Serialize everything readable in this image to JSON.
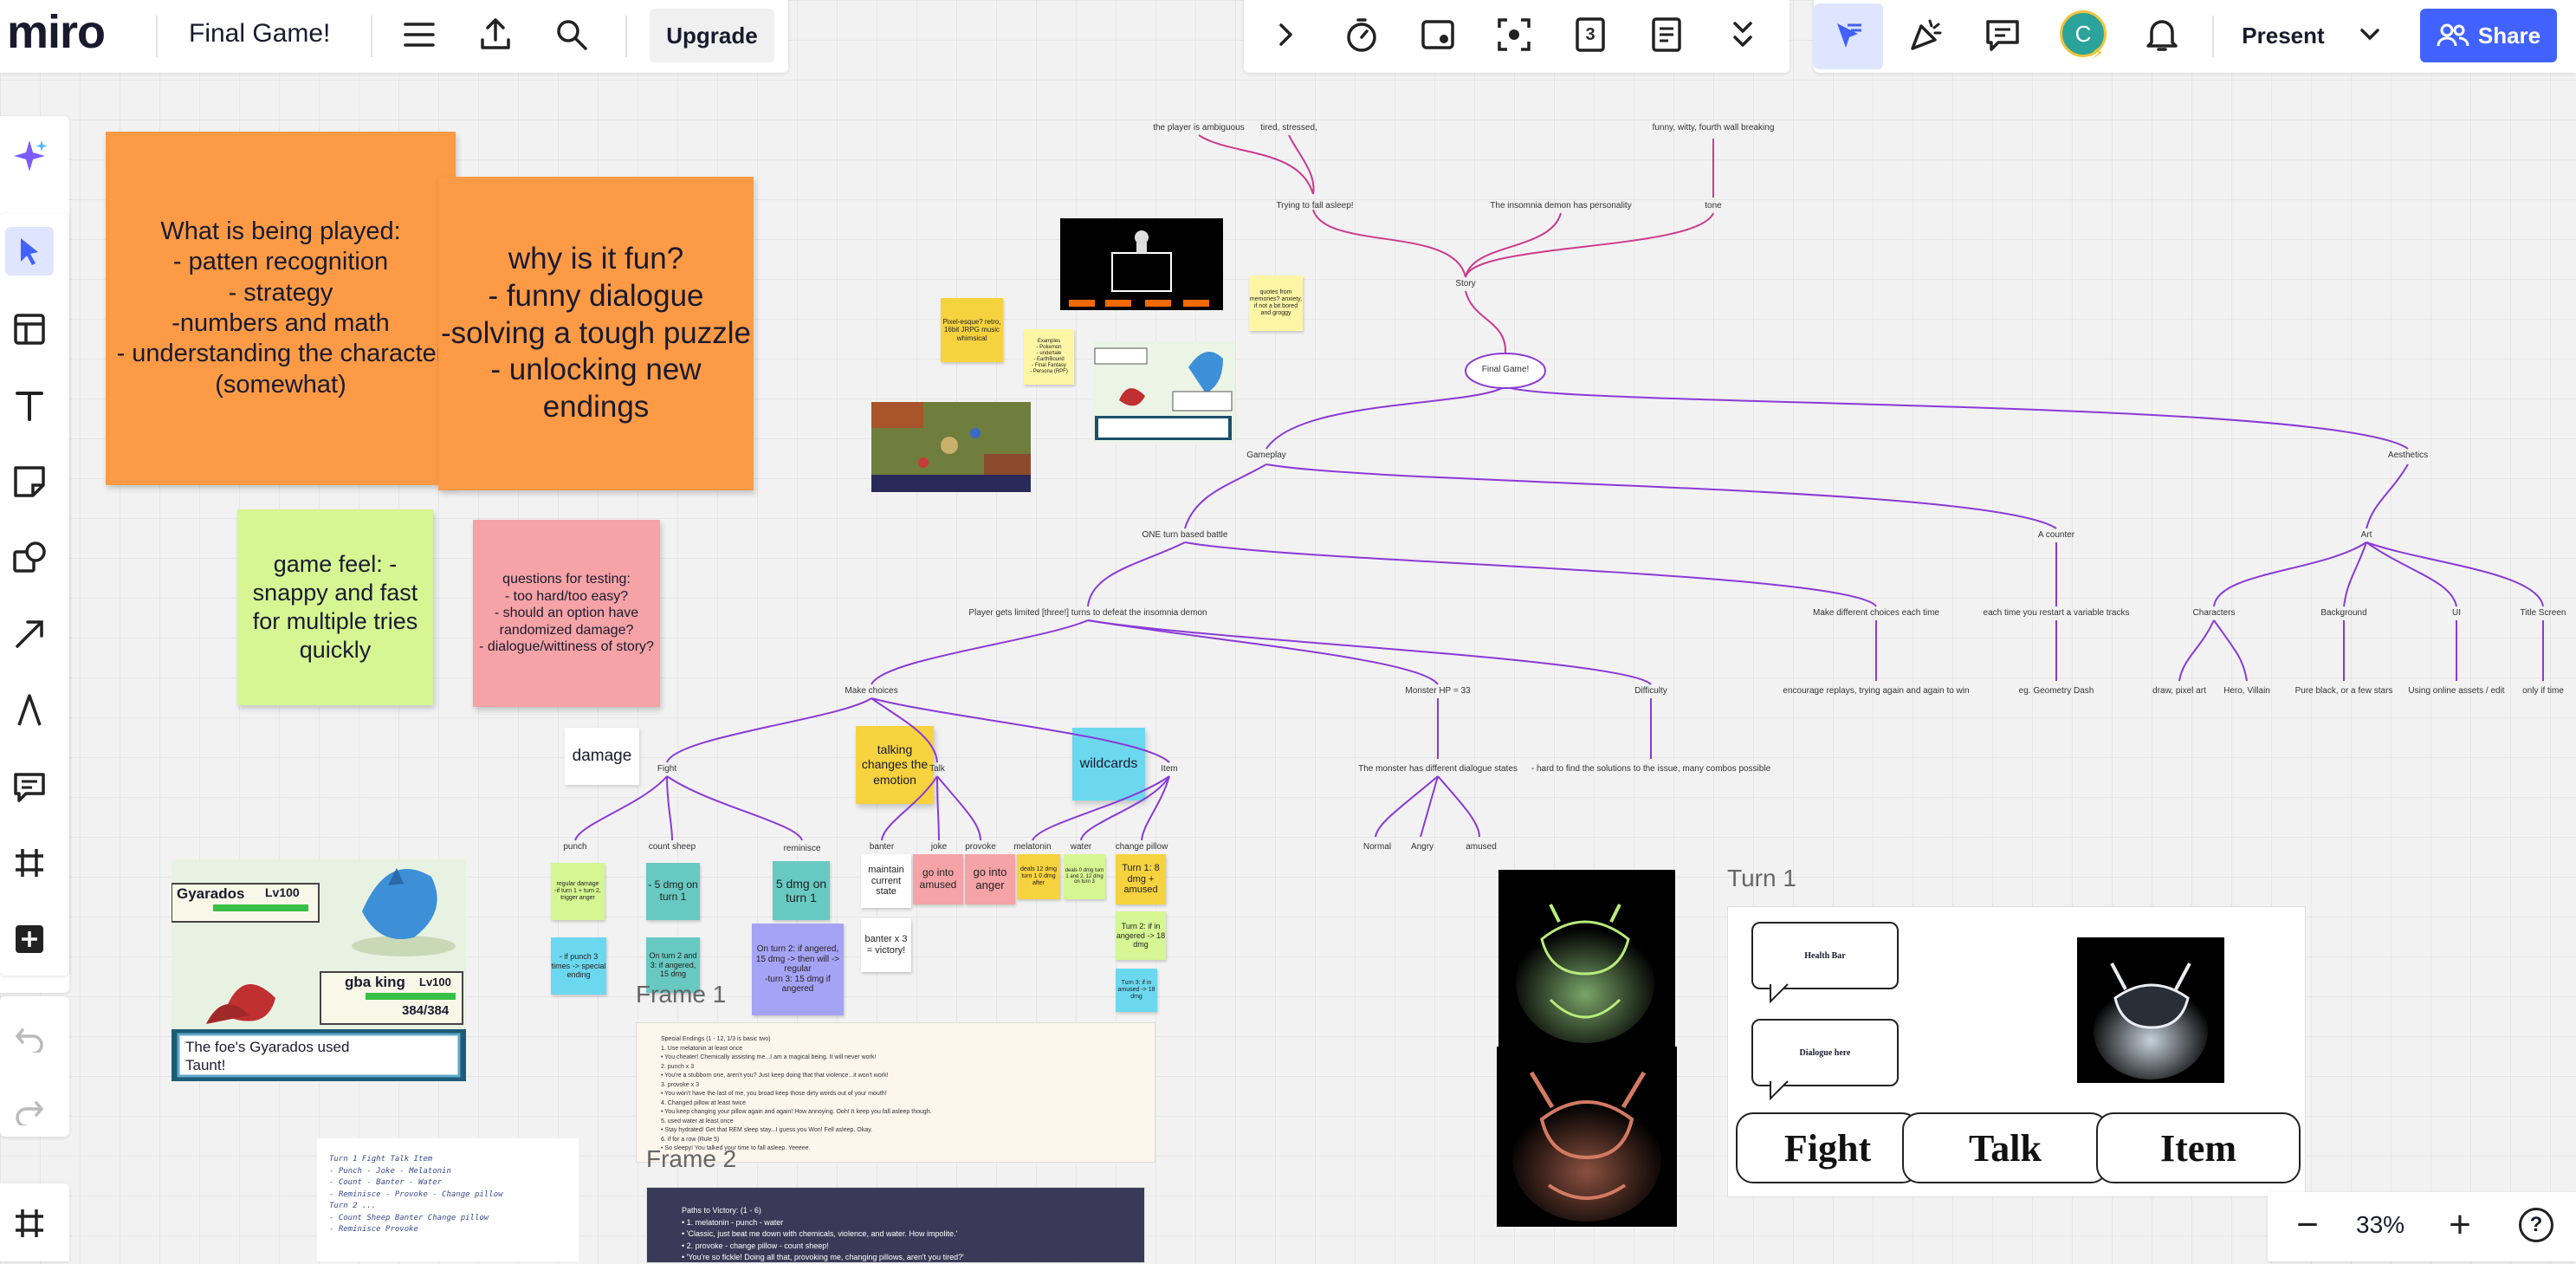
{
  "header": {
    "logo": "miro",
    "board_title": "Final Game!",
    "upgrade_label": "Upgrade",
    "present_label": "Present",
    "share_label": "Share",
    "avatar_initial": "C",
    "tool_badge": "3"
  },
  "zoom": {
    "value": "33%",
    "minus": "−",
    "plus": "+",
    "help": "?"
  },
  "stickies": {
    "played": "What is being played:\n- patten recognition\n- strategy\n-numbers and math\n- understanding the character (somewhat)",
    "fun": "why is it fun?\n- funny dialogue\n-solving a tough puzzle\n- unlocking new endings",
    "feel": "game feel: - snappy and fast for multiple tries quickly",
    "testing": "questions for testing:\n- too hard/too easy?\n- should an option have randomized damage?\n- dialogue/wittiness of story?",
    "damage": "damage",
    "talking": "talking changes the emotion",
    "wildcards": "wildcards"
  },
  "refs": {
    "pixel": "Pixel-esque? retro, 16bit JRPG music whimsical",
    "examples": "Examples\n- Pokemon\n- undertale\n- EarthBound\n- Final Fantasy\n- Persona (RPF)",
    "quotes": "quotes from memories? anxiety, if not a bit bored and groggy"
  },
  "mindmap": {
    "ambiguous": "the player is ambiguous",
    "tired": "tired, stressed,",
    "funny": "funny, witty, fourth wall breaking",
    "asleep": "Trying to fall asleep!",
    "demon_personality": "The insomnia demon has personality",
    "tone": "tone",
    "story": "Story",
    "final": "Final Game!",
    "gameplay": "Gameplay",
    "aesthetics": "Aesthetics",
    "one_turn": "ONE turn based battle",
    "counter": "A counter",
    "art": "Art",
    "limited": "Player gets limited [three!] turns to defeat the insomnia demon",
    "diff_choices": "Make different choices each time",
    "restart": "each time you restart a variable tracks",
    "characters": "Characters",
    "background": "Background",
    "ui": "UI",
    "title_screen": "Title Screen",
    "replays": "encourage replays, trying again and again to win",
    "geometry": "eg. Geometry Dash",
    "pixel_art": "draw, pixel art",
    "hero": "Hero, Villain",
    "pure_black": "Pure black, or a few stars",
    "online_assets": "Using online assets / edit",
    "only_time": "only if time",
    "make_choices": "Make choices",
    "monster_hp": "Monster HP = 33",
    "difficulty": "Difficulty",
    "fight": "Fight",
    "talk": "Talk",
    "item": "Item",
    "dialogue_states": "The monster has different dialogue states",
    "hard": "- hard to find the solutions to the issue, many combos possible",
    "normal": "Normal",
    "angry": "Angry",
    "amused": "amused",
    "punch": "punch",
    "count_sheep": "count sheep",
    "reminisce": "reminisce",
    "banter": "banter",
    "joke": "joke",
    "provoke": "provoke",
    "melatonin": "melatonin",
    "water": "water",
    "change_pillow": "change pillow"
  },
  "moves": {
    "punch_a": "regular damage\n-if turn 1 + turn 2, trigger anger",
    "punch_b": "- if punch 3 times -> special ending",
    "sheep_a": "- 5 dmg on turn 1",
    "sheep_b": "On turn 2 and 3: if angered, 15 dmg",
    "remi_a": "5 dmg on turn 1",
    "remi_b": "On turn 2: if angered, 15 dmg -> then will -> regular\n-turn 3: 15 dmg if angered",
    "banter_a": "maintain current state",
    "banter_b": "banter x 3 = victory!",
    "joke_a": "go into amused",
    "provoke_a": "go into anger",
    "mela_a": "deals 12 dmg turn 1 0 dmg after",
    "water_a": "deals 0 dmg turn 1 and 2, 12 dmg on turn 3",
    "pillow_a": "Turn 1: 8 dmg + amused",
    "pillow_b": "Turn 2: if in angered -> 18 dmg",
    "pillow_c": "Turn 3: if in amused -> 18 dmg"
  },
  "battle_screen": {
    "enemy_name": "Gyarados",
    "enemy_level": "Lv100",
    "player_name": "gba king",
    "player_level": "Lv100",
    "player_hp": "384/384",
    "message": "The foe's Gyarados used Taunt!"
  },
  "frames": {
    "frame1": "Frame 1",
    "frame2": "Frame 2",
    "turn1": "Turn 1",
    "frame1_text": "Special Endings (1 - 12, 1/3 is basic two)\n  1. Use melatonin at least once\n     • You cheater! Chemically assisting me...I am a magical being. It will never work!\n  2. punch x 3\n     • You're a stubborn one, aren't you? Just keep doing that that violence...it won't work!\n  3. provoke x 3\n     • You won't have the last of me, you broad keep those dirty words out of your mouth!\n  4. Changed pillow at least twice\n     • You keep changing your pillow again and again! How annoying. Ooh! It keep you fall asleep though.\n  5. used water at least once\n     • Stay hydrated! Get that REM sleep stay...I guess you Won! Fell asleep. Okay.\n  6. if for a row (Rule 5)\n     • So sleepy! You talked your time to fall asleep. Yeeeee.",
    "frame2_text": "Paths to Victory: (1 - 6)\n  • 1. melatonin - punch - water\n     • 'Classic, just beat me down with chemicals, violence, and water. How impolite.'\n  • 2. provoke - change pillow - count sheep!\n     • 'You're so fickle! Doing all that, provoking me, changing pillows, aren't you tired?'",
    "health_bar": "Health Bar",
    "dialogue_here": "Dialogue here",
    "fight": "Fight",
    "talk": "Talk",
    "item": "Item"
  },
  "sketch": {
    "text": "Turn 1      Fight   Talk   Item\n  - Punch     - Joke   - Melatonin\n  - Count     - Banter - Water\n  - Reminisce - Provoke - Change pillow\nTurn 2 ...\n  - Count Sheep  Banter  Change pillow\n  - Reminisce   Provoke"
  },
  "colors": {
    "orange": "#fd9a45",
    "green": "#d5f692",
    "pink": "#f5a3a6",
    "yellow": "#f6d23e",
    "cyan": "#6cd8f0",
    "teal": "#68c9c2",
    "purple_sticky": "#a5a3f5",
    "accent": "#4262ff",
    "magenta_line": "#cc3a8c",
    "purple_line": "#8a3ad6"
  }
}
